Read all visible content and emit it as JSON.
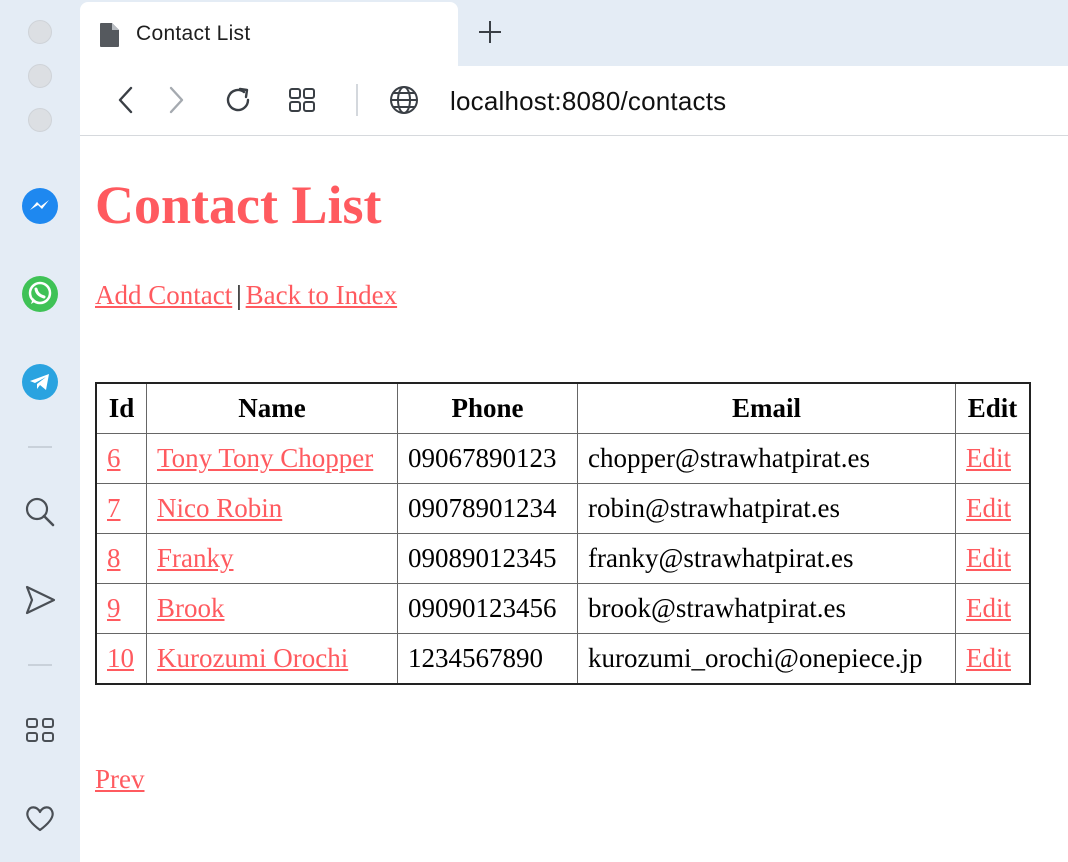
{
  "browser": {
    "tab_title": "Contact List",
    "url": "localhost:8080/contacts"
  },
  "page": {
    "title": "Contact List",
    "links": {
      "add_contact": "Add Contact",
      "separator": "|",
      "back_to_index": "Back to Index"
    },
    "table": {
      "headers": [
        "Id",
        "Name",
        "Phone",
        "Email",
        "Edit"
      ],
      "rows": [
        {
          "id": "6",
          "name": "Tony Tony Chopper",
          "phone": "09067890123",
          "email": "chopper@strawhatpirat.es",
          "edit": "Edit"
        },
        {
          "id": "7",
          "name": "Nico Robin",
          "phone": "09078901234",
          "email": "robin@strawhatpirat.es",
          "edit": "Edit"
        },
        {
          "id": "8",
          "name": "Franky",
          "phone": "09089012345",
          "email": "franky@strawhatpirat.es",
          "edit": "Edit"
        },
        {
          "id": "9",
          "name": "Brook",
          "phone": "09090123456",
          "email": "brook@strawhatpirat.es",
          "edit": "Edit"
        },
        {
          "id": "10",
          "name": "Kurozumi Orochi",
          "phone": "1234567890",
          "email": "kurozumi_orochi@onepiece.jp",
          "edit": "Edit"
        }
      ]
    },
    "pager": {
      "prev": "Prev"
    }
  },
  "icons": {
    "tab": "page-icon",
    "new_tab": "plus-icon",
    "back": "chevron-left-icon",
    "forward": "chevron-right-icon",
    "reload": "reload-icon",
    "tabs_grid": "grid-icon",
    "site": "globe-icon",
    "sidebar": [
      "messenger-icon",
      "whatsapp-icon",
      "telegram-icon",
      "search-icon",
      "send-icon",
      "apps-icon",
      "heart-icon"
    ]
  },
  "colors": {
    "accent": "#ff5a5f",
    "chrome_bg": "#e4ecf5",
    "messenger": "#1e88f0",
    "whatsapp": "#3fc256",
    "telegram": "#2aa3e0"
  }
}
